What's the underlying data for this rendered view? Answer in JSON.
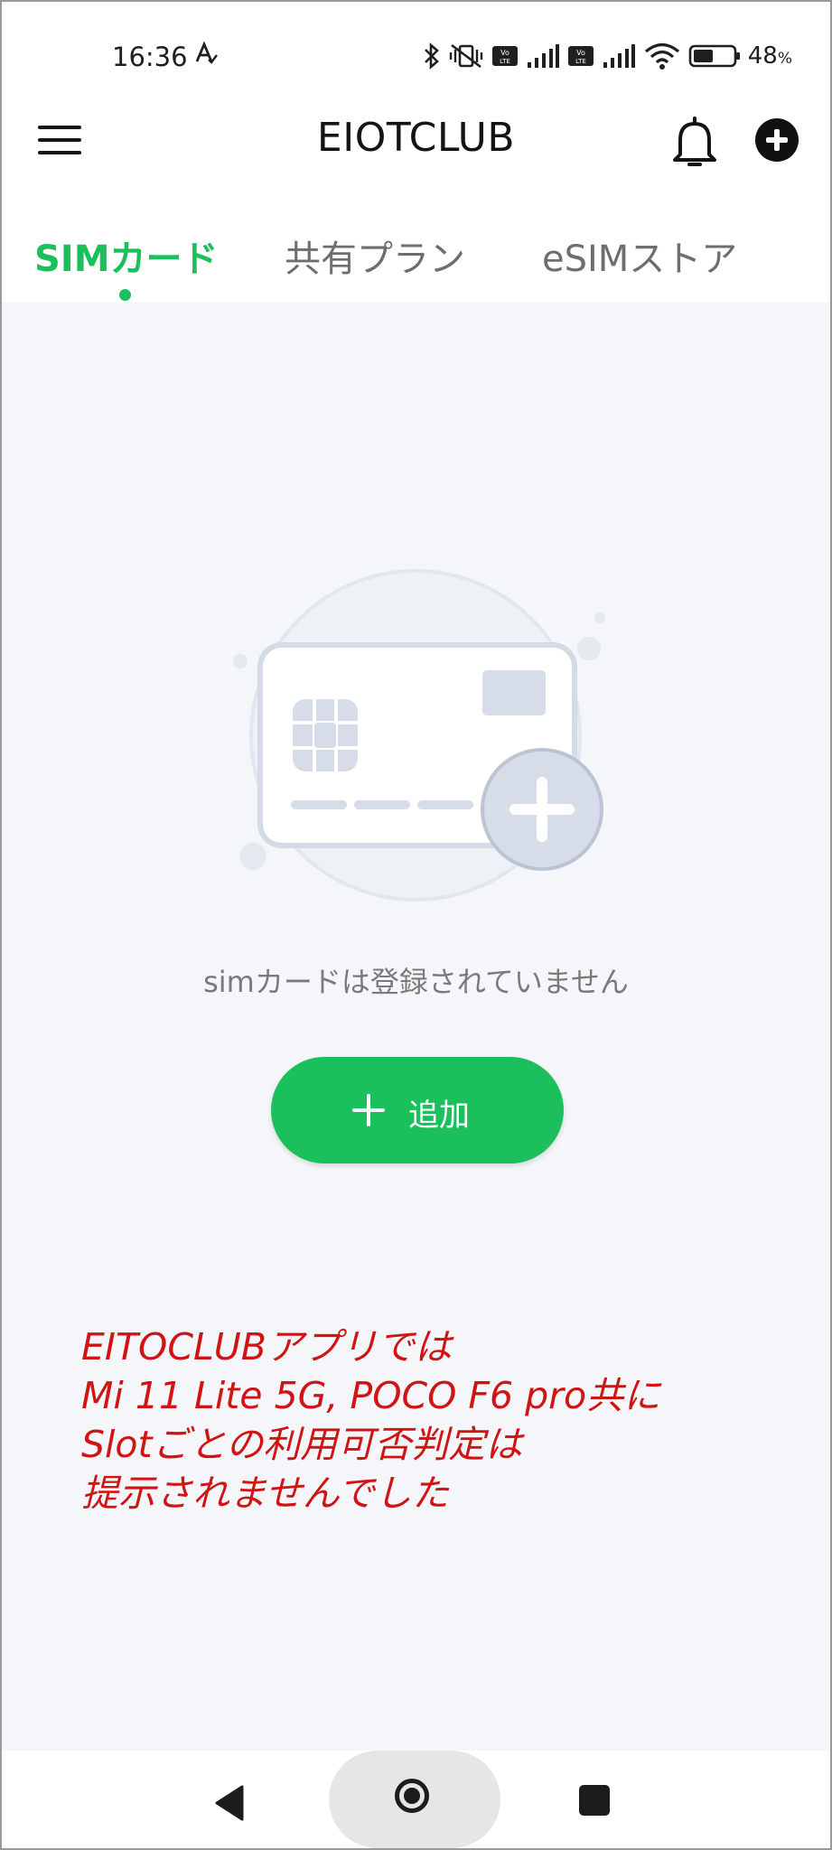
{
  "colors": {
    "accent": "#1bbf5c",
    "note": "#d01414",
    "background": "#f4f6f9"
  },
  "status_bar": {
    "time": "16:36",
    "battery_text": "48",
    "battery_unit": "%",
    "icons": [
      "bluetooth-icon",
      "vibrate-icon",
      "volte-icon",
      "signal-icon",
      "volte-icon",
      "signal-icon",
      "wifi-icon",
      "battery-icon"
    ]
  },
  "app_bar": {
    "title": "EIOTCLUB",
    "icons": [
      "menu-icon",
      "bell-icon",
      "add-icon"
    ]
  },
  "tabs": [
    {
      "label": "SIMカード",
      "active": true
    },
    {
      "label": "共有プラン",
      "active": false
    },
    {
      "label": "eSIMストア",
      "active": false
    }
  ],
  "empty_state": {
    "message": "simカードは登録されていません",
    "button_label": "追加"
  },
  "note_lines": [
    "EITOCLUBアプリでは",
    "Mi 11 Lite 5G, POCO F6 pro共に",
    "Slotごとの利用可否判定は",
    "提示されませんでした"
  ],
  "nav_bar": {
    "icons": [
      "back-icon",
      "home-icon",
      "recents-icon"
    ]
  }
}
